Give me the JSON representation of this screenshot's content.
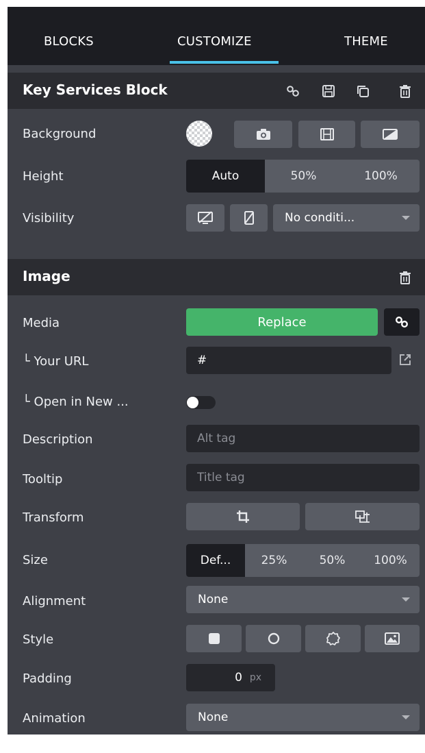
{
  "tabs": [
    {
      "label": "BLOCKS",
      "active": false
    },
    {
      "label": "CUSTOMIZE",
      "active": true
    },
    {
      "label": "THEME",
      "active": false
    }
  ],
  "accent_color": "#49c1e8",
  "block_section": {
    "title": "Key Services Block",
    "header_icons": [
      "link-icon",
      "save-icon",
      "duplicate-icon",
      "trash-icon"
    ],
    "background": {
      "label": "Background",
      "options": [
        "transparent-swatch-icon",
        "camera-icon",
        "film-icon",
        "gradient-icon"
      ]
    },
    "height": {
      "label": "Height",
      "options": [
        "Auto",
        "50%",
        "100%"
      ],
      "selected": "Auto"
    },
    "visibility": {
      "label": "Visibility",
      "icons": [
        "hide-desktop-icon",
        "hide-mobile-icon"
      ],
      "condition": "No conditi..."
    }
  },
  "image_section": {
    "title": "Image",
    "header_icons": [
      "trash-icon"
    ],
    "media": {
      "label": "Media",
      "button": "Replace"
    },
    "url": {
      "label": "└ Your URL",
      "value": "#"
    },
    "new_tab": {
      "label": "└ Open in New ...",
      "enabled": false
    },
    "description": {
      "label": "Description",
      "placeholder": "Alt tag"
    },
    "tooltip": {
      "label": "Tooltip",
      "placeholder": "Title tag"
    },
    "transform": {
      "label": "Transform",
      "icons": [
        "crop-icon",
        "resize-icon"
      ]
    },
    "size": {
      "label": "Size",
      "options": [
        "Def...",
        "25%",
        "50%",
        "100%"
      ],
      "selected": "Def..."
    },
    "alignment": {
      "label": "Alignment",
      "value": "None"
    },
    "style": {
      "label": "Style",
      "icons": [
        "square-style-icon",
        "circle-style-icon",
        "badge-style-icon",
        "image-style-icon"
      ]
    },
    "padding": {
      "label": "Padding",
      "value": "0",
      "unit": "px"
    },
    "animation": {
      "label": "Animation",
      "value": "None"
    }
  }
}
